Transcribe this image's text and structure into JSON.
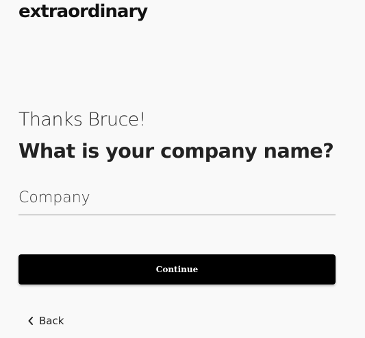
{
  "brand": {
    "logo_text": "extraordinary"
  },
  "form": {
    "greeting": "Thanks Bruce!",
    "question": "What is your company name?",
    "company_input": {
      "value": "",
      "placeholder": "Company"
    },
    "continue_label": "Continue",
    "back_label": "Back",
    "back_icon": "chevron-left-icon"
  },
  "colors": {
    "background": "#f9f9f9",
    "button": "#000000",
    "button_text": "#ffffff",
    "text": "#1e1e1e"
  }
}
